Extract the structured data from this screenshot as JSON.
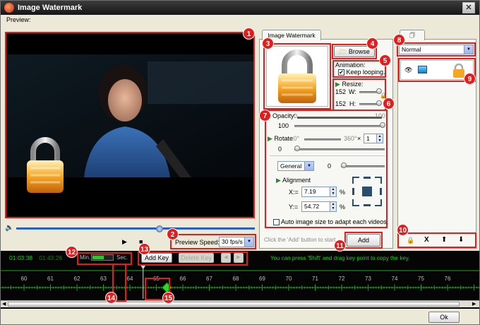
{
  "window": {
    "title": "Image Watermark",
    "close_glyph": "✕"
  },
  "menubar": {
    "preview_label": "Preview:"
  },
  "markers": [
    "1",
    "2",
    "3",
    "4",
    "5",
    "6",
    "7",
    "8",
    "9",
    "10",
    "11",
    "12",
    "13",
    "14",
    "15"
  ],
  "preview": {
    "speed_label": "Preview Speed:",
    "speed_value": "30 fps/s",
    "position": 0.6
  },
  "watermark_tab": {
    "tab_label": "Image Watermark",
    "browse_label": "Browse",
    "animation_label": "Animation:",
    "keep_looping_label": "Keep looping.",
    "keep_looping_checked": true,
    "resize_label": "Resize:",
    "width_value": "152",
    "width_label": "W:",
    "height_value": "152",
    "height_label": "H:",
    "opacity_label": "Opacity:",
    "opacity_min": "0",
    "opacity_max": "100",
    "opacity_value": "100",
    "rotate_label": "Rotate",
    "rotate_min": ":0°",
    "rotate_max": "360°",
    "rotate_times": "×",
    "rotate_multiplier": "1",
    "rotate_value": "0",
    "blend_mode": "General",
    "blend_value": "0",
    "alignment_label": "Alignment",
    "x_label": "X:=",
    "x_value": "7.19",
    "x_unit": "%",
    "y_label": "Y:=",
    "y_value": "54.72",
    "y_unit": "%",
    "auto_size_label": "Auto image size to adapt each videos.",
    "hint_text": "Click the 'Add' button to start",
    "add_label": "Add"
  },
  "layers": {
    "mode": "Normal",
    "tool_glyphs": [
      "🔒",
      "X",
      "⬆",
      "⬇"
    ]
  },
  "timeline": {
    "current_time": "01:03:38",
    "total_time": "01:43:26",
    "zoom_min_label": "Min.",
    "zoom_sec_label": "Sec.",
    "add_key_label": "Add Key",
    "delete_key_label": "Delete Key",
    "prev_key_glyph": "◀",
    "next_key_glyph": "▶",
    "hint": "You can press 'Shift' and drag key point to copy the key.",
    "ticks": [
      "60",
      "61",
      "62",
      "63",
      "64",
      "65",
      "66",
      "67",
      "68",
      "69",
      "70",
      "71",
      "72",
      "73",
      "74",
      "75",
      "76"
    ],
    "key_position_sec": 65.4,
    "playhead_sec": 64.5
  },
  "footer": {
    "ok_label": "Ok"
  },
  "colors": {
    "marker": "#e41c1c",
    "timeline_bg": "#050505",
    "timeline_grid": "#1ea31e",
    "key_point": "#22dd22",
    "hint_green": "#00e000"
  }
}
